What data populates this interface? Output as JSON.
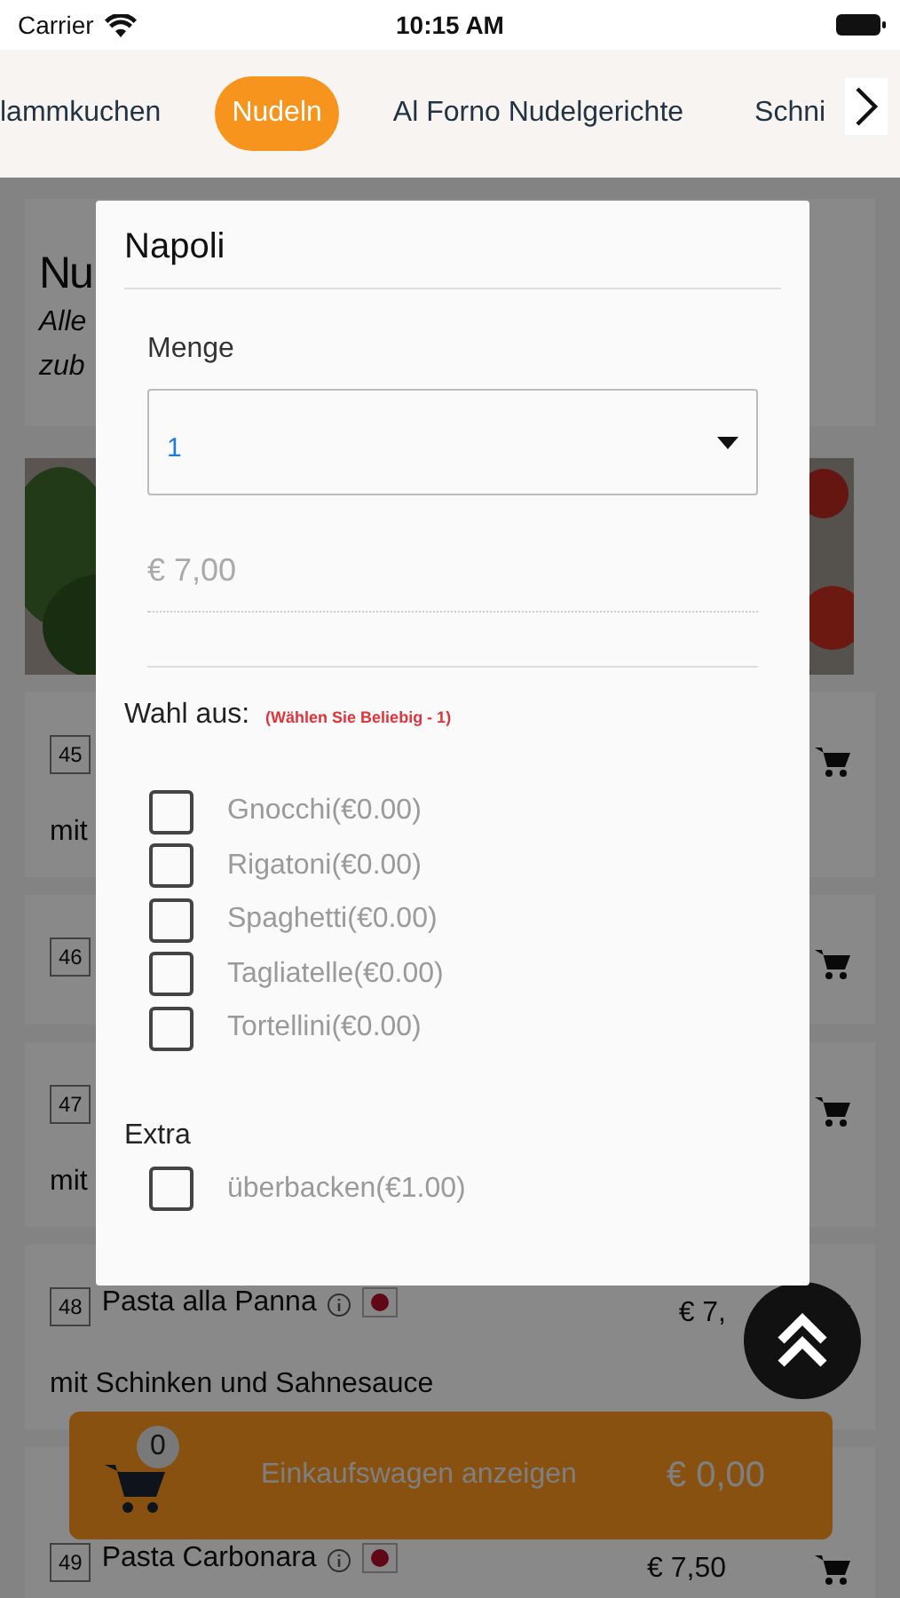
{
  "status_bar": {
    "carrier": "Carrier",
    "time": "10:15 AM"
  },
  "categories": [
    {
      "label": "lammkuchen",
      "selected": false
    },
    {
      "label": "Nudeln",
      "selected": true
    },
    {
      "label": "Al Forno Nudelgerichte",
      "selected": false
    },
    {
      "label": "Schni",
      "selected": false
    }
  ],
  "background": {
    "heading": "Nu",
    "subtitle_lines": [
      "Alle",
      "zub"
    ],
    "items": [
      {
        "number": "45",
        "description": "mit"
      },
      {
        "number": "46"
      },
      {
        "number": "47",
        "description": "mit"
      },
      {
        "number": "48",
        "name": "Pasta alla Panna",
        "price": "€ 7,",
        "description": "mit Schinken und Sahnesauce"
      },
      {
        "number": "49",
        "name": "Pasta Carbonara",
        "price": "€ 7,50"
      }
    ]
  },
  "dialog": {
    "title": "Napoli",
    "quantity_label": "Menge",
    "quantity_value": "1",
    "price": "€ 7,00",
    "groups": [
      {
        "title": "Wahl aus:",
        "hint": "(Wählen Sie Beliebig - 1)",
        "options": [
          {
            "label": "Gnocchi(€0.00)",
            "checked": false
          },
          {
            "label": "Rigatoni(€0.00)",
            "checked": false
          },
          {
            "label": "Spaghetti(€0.00)",
            "checked": false
          },
          {
            "label": "Tagliatelle(€0.00)",
            "checked": false
          },
          {
            "label": "Tortellini(€0.00)",
            "checked": false
          }
        ]
      },
      {
        "title": "Extra",
        "options": [
          {
            "label": "überbacken(€1.00)",
            "checked": false
          }
        ]
      }
    ]
  },
  "cart_bar": {
    "count": "0",
    "label": "Einkaufswagen anzeigen",
    "total": "€ 0,00"
  }
}
